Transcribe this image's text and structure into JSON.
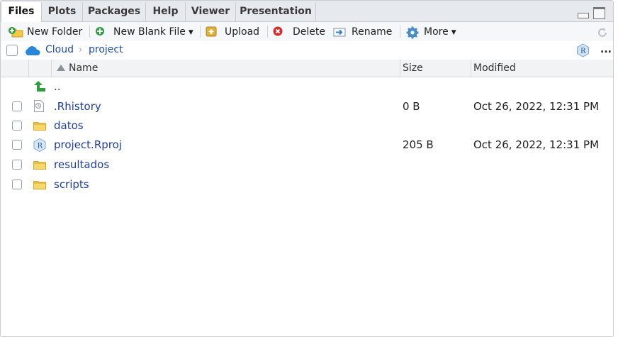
{
  "tabs": [
    "Files",
    "Plots",
    "Packages",
    "Help",
    "Viewer",
    "Presentation"
  ],
  "toolbar": {
    "new_folder": "New Folder",
    "new_blank_file": "New Blank File",
    "upload": "Upload",
    "delete": "Delete",
    "rename": "Rename",
    "more": "More"
  },
  "breadcrumb": {
    "root": "Cloud",
    "current": "project",
    "more": "..."
  },
  "columns": {
    "name": "Name",
    "size": "Size",
    "modified": "Modified"
  },
  "parent_dir": "..",
  "files": [
    {
      "name": ".Rhistory",
      "size": "0 B",
      "modified": "Oct 26, 2022, 12:31 PM",
      "icon": "history-file-icon"
    },
    {
      "name": "datos",
      "size": "",
      "modified": "",
      "icon": "folder-icon"
    },
    {
      "name": "project.Rproj",
      "size": "205 B",
      "modified": "Oct 26, 2022, 12:31 PM",
      "icon": "rproj-icon"
    },
    {
      "name": "resultados",
      "size": "",
      "modified": "",
      "icon": "folder-icon"
    },
    {
      "name": "scripts",
      "size": "",
      "modified": "",
      "icon": "folder-icon"
    }
  ],
  "colors": {
    "link": "#1f3f9c",
    "tab_bg": "#e6e9ed",
    "folder": "#f3c84b",
    "green_arrow": "#2e9e3e"
  }
}
